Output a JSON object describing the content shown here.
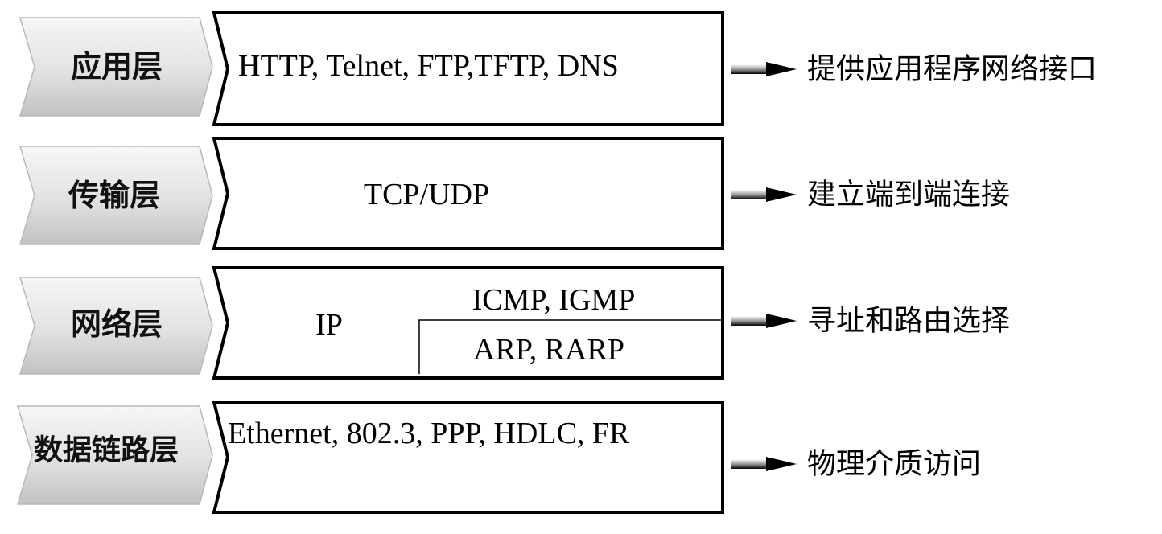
{
  "layers": [
    {
      "label": "应用层",
      "protocols": "HTTP, Telnet, FTP,TFTP, DNS",
      "description": "提供应用程序网络接口"
    },
    {
      "label": "传输层",
      "protocols": "TCP/UDP",
      "description": "建立端到端连接"
    },
    {
      "label": "网络层",
      "protocols": "IP",
      "sub_protocols_top": "ICMP, IGMP",
      "sub_protocols_bottom": "ARP, RARP",
      "description": "寻址和路由选择"
    },
    {
      "label": "数据链路层",
      "protocols": "Ethernet, 802.3, PPP, HDLC, FR",
      "description": "物理介质访问"
    }
  ],
  "colors": {
    "chevron_light": "#f4f4f4",
    "chevron_dark": "#c4c4c4",
    "box_stroke": "#000000",
    "arrow": "#000000"
  }
}
